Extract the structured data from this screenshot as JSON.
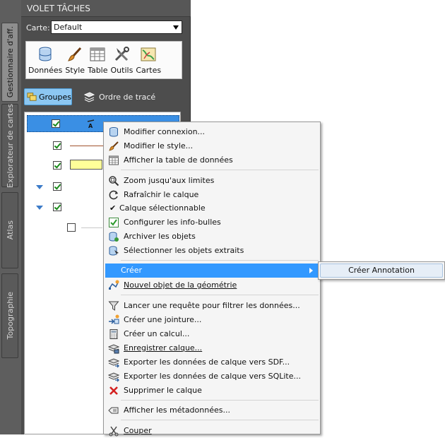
{
  "tabs": [
    {
      "label": "Gestionnaire d'aff.",
      "active": true
    },
    {
      "label": "Explorateur de cartes",
      "active": false
    },
    {
      "label": "Atlas",
      "active": false
    },
    {
      "label": "Topographie",
      "active": false
    }
  ],
  "pane": {
    "title": "VOLET TÂCHES",
    "map_label": "Carte:",
    "map_value": "Default",
    "tools": [
      {
        "label": "Données",
        "icon": "database-icon"
      },
      {
        "label": "Style",
        "icon": "brush-icon"
      },
      {
        "label": "Table",
        "icon": "table-icon"
      },
      {
        "label": "Outils",
        "icon": "tools-icon"
      },
      {
        "label": "Cartes",
        "icon": "maps-icon"
      }
    ],
    "groups_label": "Groupes",
    "order_label": "Ordre de tracé"
  },
  "menu": {
    "items": [
      {
        "label": "Modifier connexion...",
        "icon": "connection-icon"
      },
      {
        "label": "Modifier le style...",
        "icon": "brush-icon"
      },
      {
        "label": "Afficher la table de données",
        "icon": "table-icon"
      },
      {
        "label": "Zoom jusqu'aux limites",
        "icon": "zoom-extents-icon"
      },
      {
        "label": "Rafraîchir le calque",
        "icon": "refresh-icon"
      },
      {
        "label": "Calque sélectionnable",
        "icon": "check-icon"
      },
      {
        "label": "Configurer les info-bulles",
        "icon": "tooltip-config-icon"
      },
      {
        "label": "Archiver les objets",
        "icon": "archive-icon"
      },
      {
        "label": "Sélectionner les objets extraits",
        "icon": "select-extracted-icon"
      },
      {
        "label": "Créer",
        "icon": "none"
      },
      {
        "label": "Nouvel objet de la géométrie",
        "icon": "new-geometry-icon"
      },
      {
        "label": "Lancer une requête pour filtrer les données...",
        "icon": "filter-icon"
      },
      {
        "label": "Créer une jointure...",
        "icon": "join-icon"
      },
      {
        "label": "Créer un calcul...",
        "icon": "calculator-icon"
      },
      {
        "label": "Enregistrer calque...",
        "icon": "save-layer-icon"
      },
      {
        "label": "Exporter les données de calque vers SDF...",
        "icon": "export-sdf-icon"
      },
      {
        "label": "Exporter les données de calque vers SQLite...",
        "icon": "export-sqlite-icon"
      },
      {
        "label": "Supprimer le calque",
        "icon": "delete-icon"
      },
      {
        "label": "Afficher les métadonnées...",
        "icon": "metadata-icon"
      },
      {
        "label": "Couper",
        "icon": "cut-icon"
      }
    ],
    "submenu_item": "Créer Annotation"
  },
  "colors": {
    "highlight": "#3399ff",
    "groups_button": "#8cc7f2",
    "layer_swatch": "#ffff99",
    "pane_bg": "#4d4d4d"
  }
}
